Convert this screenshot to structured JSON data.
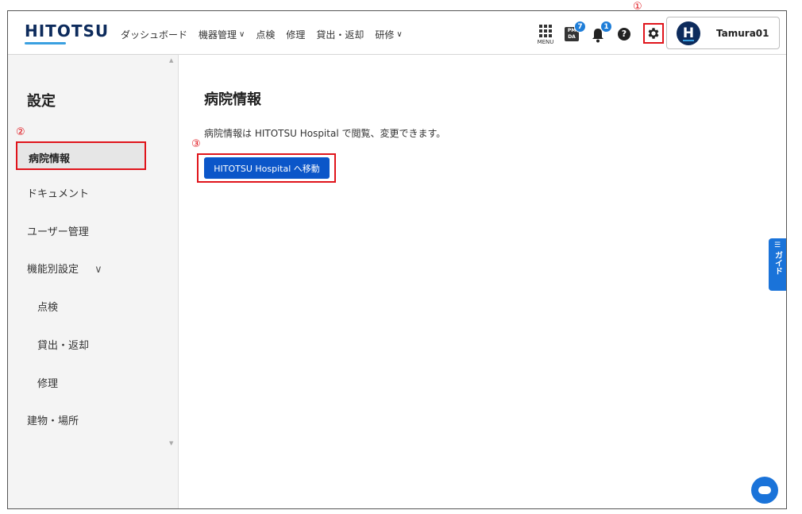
{
  "header": {
    "logo": "HITOTSU",
    "nav": [
      {
        "label": "ダッシュボード",
        "dropdown": false
      },
      {
        "label": "機器管理",
        "dropdown": true
      },
      {
        "label": "点検",
        "dropdown": false
      },
      {
        "label": "修理",
        "dropdown": false
      },
      {
        "label": "貸出・返却",
        "dropdown": false
      },
      {
        "label": "研修",
        "dropdown": true
      }
    ],
    "menu_label": "MENU",
    "pmda_label": "PM DA",
    "pmda_badge": "7",
    "notification_badge": "1",
    "help_label": "?",
    "user": {
      "initial": "H",
      "name": "Tamura01"
    }
  },
  "annotations": {
    "one": "①",
    "two": "②",
    "three": "③"
  },
  "sidebar": {
    "title": "設定",
    "active_item": "病院情報",
    "items": [
      {
        "label": "ドキュメント"
      },
      {
        "label": "ユーザー管理"
      },
      {
        "label": "機能別設定"
      },
      {
        "label": "点検"
      },
      {
        "label": "貸出・返却"
      },
      {
        "label": "修理"
      },
      {
        "label": "建物・場所"
      }
    ],
    "expand_icon": "⌄"
  },
  "main": {
    "title": "病院情報",
    "description": "病院情報は HITOTSU Hospital で閲覧、変更できます。",
    "button_label": "HITOTSU Hospital へ移動"
  },
  "guide": {
    "label": "ガイド"
  },
  "colors": {
    "primary": "#0b56c9",
    "brand": "#0d2b5c",
    "annotation": "#e0141b",
    "badge": "#1f7ed8"
  }
}
